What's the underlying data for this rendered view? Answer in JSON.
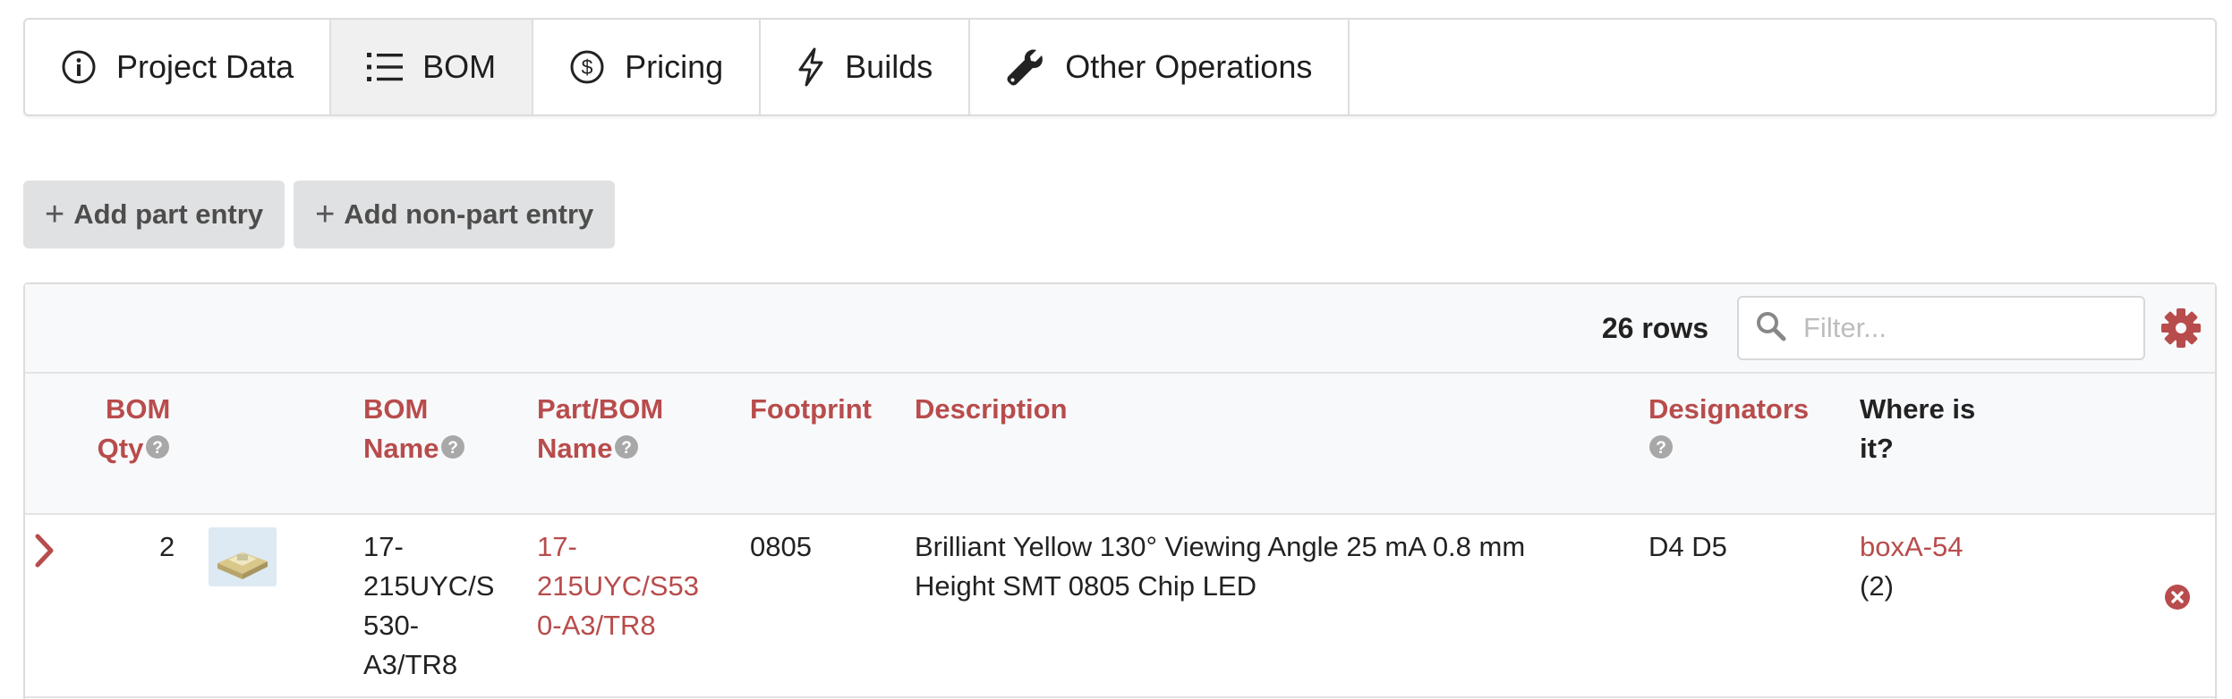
{
  "tabs": [
    {
      "label": "Project Data",
      "icon": "info-circle-icon"
    },
    {
      "label": "BOM",
      "icon": "list-icon"
    },
    {
      "label": "Pricing",
      "icon": "dollar-circle-icon"
    },
    {
      "label": "Builds",
      "icon": "bolt-icon"
    },
    {
      "label": "Other Operations",
      "icon": "wrench-icon"
    }
  ],
  "active_tab": "BOM",
  "actions": {
    "add_part": "Add part entry",
    "add_non_part": "Add non-part entry"
  },
  "table": {
    "row_count": "26 rows",
    "filter_placeholder": "Filter...",
    "headers": {
      "qty_line1": "BOM",
      "qty_line2": "Qty",
      "bom_name_line1": "BOM",
      "bom_name_line2": "Name",
      "part_name_line1": "Part/BOM",
      "part_name_line2": "Name",
      "footprint": "Footprint",
      "description": "Description",
      "designators": "Designators",
      "where_line1": "Where is",
      "where_line2": "it?"
    },
    "rows": [
      {
        "qty": "2",
        "bom_name_lines": [
          "17-",
          "215UYC/S",
          "530-",
          "A3/TR8"
        ],
        "part_name_lines": [
          "17-",
          "215UYC/S53",
          "0-A3/TR8"
        ],
        "footprint": "0805",
        "description_lines": [
          "Brilliant Yellow 130° Viewing Angle 25 mA 0.8 mm",
          "Height SMT 0805 Chip LED"
        ],
        "designators": "D4 D5",
        "location": "boxA-54",
        "location_qty": "(2)"
      }
    ]
  },
  "colors": {
    "accent_red": "#b84c4c",
    "header_bg": "#f8f9fb",
    "button_bg": "#e0e1e2",
    "active_tab_bg": "#f0f0f0"
  }
}
